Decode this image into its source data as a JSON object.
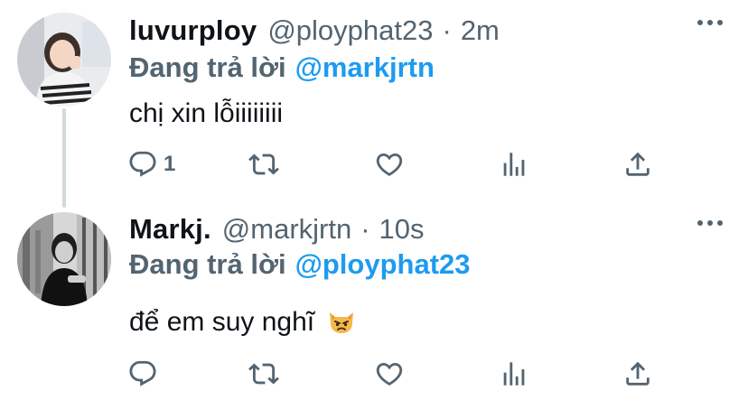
{
  "tweets": [
    {
      "display_name": "luvurploy",
      "handle": "@ployphat23",
      "separator": "·",
      "time": "2m",
      "reply_prefix": "Đang trả lời",
      "reply_to": "@markjrtn",
      "text": "chị xin lỗiiiiiiii",
      "reply_count": "1"
    },
    {
      "display_name": "Markj.",
      "handle": "@markjrtn",
      "separator": "·",
      "time": "10s",
      "reply_prefix": "Đang trả lời",
      "reply_to": "@ployphat23",
      "text": "để em suy nghĩ",
      "reply_count": ""
    }
  ],
  "icons": {
    "reply": "reply-icon",
    "retweet": "retweet-icon",
    "like": "heart-icon",
    "stats": "analytics-icon",
    "share": "share-icon",
    "more": "more-dots-icon",
    "emoji": "pouting-cat-emoji-icon"
  },
  "colors": {
    "text": "#0f1419",
    "secondary": "#536471",
    "link": "#1d9bf0",
    "thread_line": "#cfd9de"
  }
}
